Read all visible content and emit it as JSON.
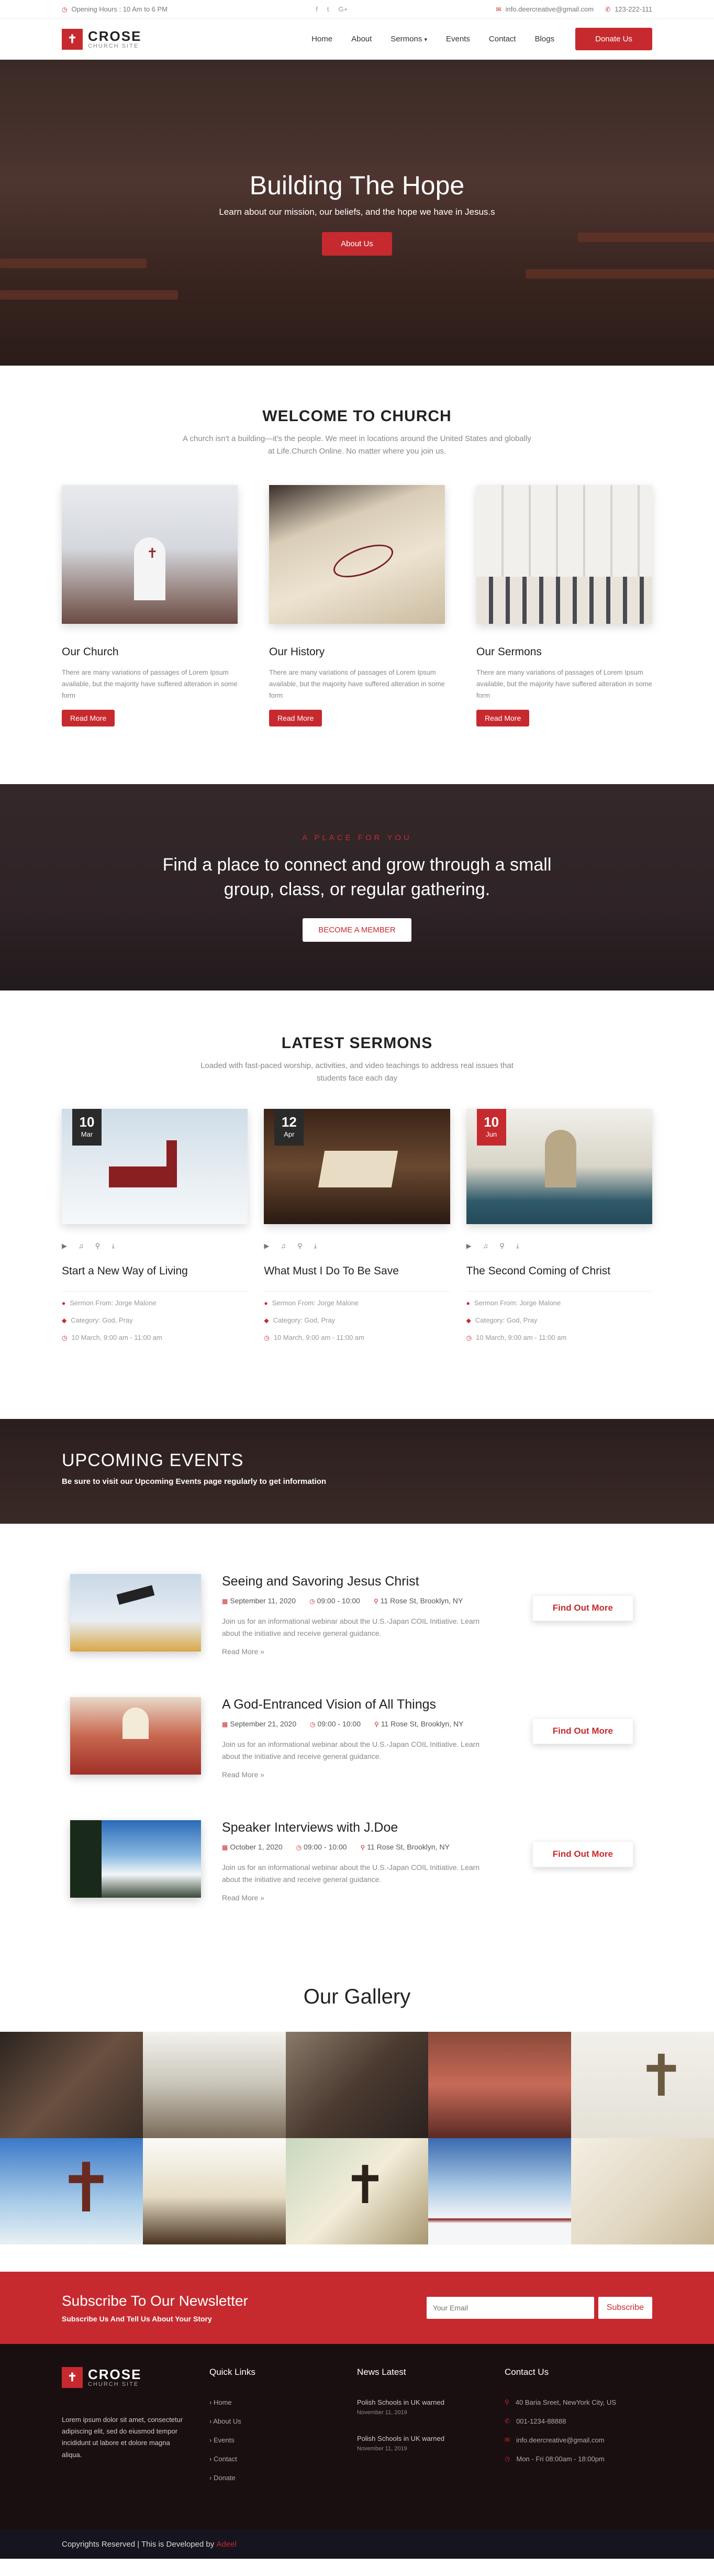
{
  "topbar": {
    "hours": "Opening Hours : 10 Am to 6 PM",
    "social": [
      "f",
      "t",
      "G+"
    ],
    "email": "info.deercreative@gmail.com",
    "phone": "123-222-111"
  },
  "header": {
    "logo_name": "CROSE",
    "logo_sub": "CHURCH SITE",
    "nav": [
      "Home",
      "About",
      "Sermons",
      "Events",
      "Contact",
      "Blogs"
    ],
    "donate": "Donate Us"
  },
  "hero": {
    "title": "Building The Hope",
    "subtitle": "Learn about our mission, our beliefs, and the hope we have in Jesus.s",
    "button": "About Us"
  },
  "welcome": {
    "title": "WELCOME TO CHURCH",
    "subtitle": "A church isn't a building—it's the people. We meet in locations around the United States and globally at Life.Church Online. No matter where you join us.",
    "cards": [
      {
        "title": "Our Church",
        "text": "There are many variations of passages of Lorem Ipsum available, but the majority have suffered alteration in some form",
        "button": "Read More"
      },
      {
        "title": "Our History",
        "text": "There are many variations of passages of Lorem Ipsum available, but the majority have suffered alteration in some form",
        "button": "Read More"
      },
      {
        "title": "Our Sermons",
        "text": "There are many variations of passages of Lorem Ipsum available, but the majority have suffered alteration in some form",
        "button": "Read More"
      }
    ]
  },
  "place": {
    "kicker": "A PLACE FOR YOU",
    "title": "Find a place to connect and grow through a small group, class, or regular gathering.",
    "button": "BECOME A MEMBER"
  },
  "sermons": {
    "title": "LATEST SERMONS",
    "subtitle": "Loaded with fast-paced worship, activities, and video teachings to address real issues that students face each day",
    "items": [
      {
        "day": "10",
        "month": "Mar",
        "title": "Start a New Way of Living",
        "from": "Sermon From: Jorge Malone",
        "category": "Category: God, Pray",
        "time": "10 March, 9:00 am - 11:00 am"
      },
      {
        "day": "12",
        "month": "Apr",
        "title": "What Must I Do To Be Save",
        "from": "Sermon From: Jorge Malone",
        "category": "Category: God, Pray",
        "time": "10 March, 9:00 am - 11:00 am"
      },
      {
        "day": "10",
        "month": "Jun",
        "title": "The Second Coming of Christ",
        "from": "Sermon From: Jorge Malone",
        "category": "Category: God, Pray",
        "time": "10 March, 9:00 am - 11:00 am"
      }
    ]
  },
  "events_banner": {
    "title": "UPCOMING EVENTS",
    "subtitle": "Be sure to visit our Upcoming Events page regularly to get information"
  },
  "events": [
    {
      "title": "Seeing and Savoring Jesus Christ",
      "date": "September 11, 2020",
      "time": "09:00 - 10:00",
      "location": "11 Rose St, Brooklyn, NY",
      "text": "Join us for an informational webinar about the U.S.-Japan COIL Initiative. Learn about the initiative and receive general guidance.",
      "read": "Read More »",
      "button": "Find Out More"
    },
    {
      "title": "A God-Entranced Vision of All Things",
      "date": "September 21, 2020",
      "time": "09:00 - 10:00",
      "location": "11 Rose St, Brooklyn, NY",
      "text": "Join us for an informational webinar about the U.S.-Japan COIL Initiative. Learn about the initiative and receive general guidance.",
      "read": "Read More »",
      "button": "Find Out More"
    },
    {
      "title": "Speaker Interviews with J.Doe",
      "date": "October 1, 2020",
      "time": "09:00 - 10:00",
      "location": "11 Rose St, Brooklyn, NY",
      "text": "Join us for an informational webinar about the U.S.-Japan COIL Initiative. Learn about the initiative and receive general guidance.",
      "read": "Read More »",
      "button": "Find Out More"
    }
  ],
  "gallery": {
    "title": "Our Gallery"
  },
  "newsletter": {
    "title": "Subscribe To Our Newsletter",
    "subtitle": "Subscribe Us And Tell Us About Your Story",
    "placeholder": "Your Email",
    "button": "Subscribe"
  },
  "footer": {
    "logo_name": "CROSE",
    "logo_sub": "CHURCH SITE",
    "about": "Lorem ipsum dolor sit amet, consectetur adipiscing elit, sed do eiusmod tempor incididunt ut labore et dolore magna aliqua.",
    "quick_title": "Quick Links",
    "quick_links": [
      "Home",
      "About Us",
      "Events",
      "Contact",
      "Donate"
    ],
    "news_title": "News Latest",
    "news": [
      {
        "title": "Polish Schools in UK warned",
        "date": "November 11, 2019"
      },
      {
        "title": "Polish Schools in UK warned",
        "date": "November 11, 2019"
      }
    ],
    "contact_title": "Contact Us",
    "contact": [
      "40 Baria Sreet, NewYork City, US",
      "001-1234-88888",
      "info.deercreative@gmail.com",
      "Mon - Fri 08:00am - 18:00pm"
    ],
    "copyright": "Copyrights Reserved | This is Developed by",
    "author": "Adeel"
  },
  "colors": {
    "accent": "#c62a2f",
    "dark": "#1a0f10"
  }
}
